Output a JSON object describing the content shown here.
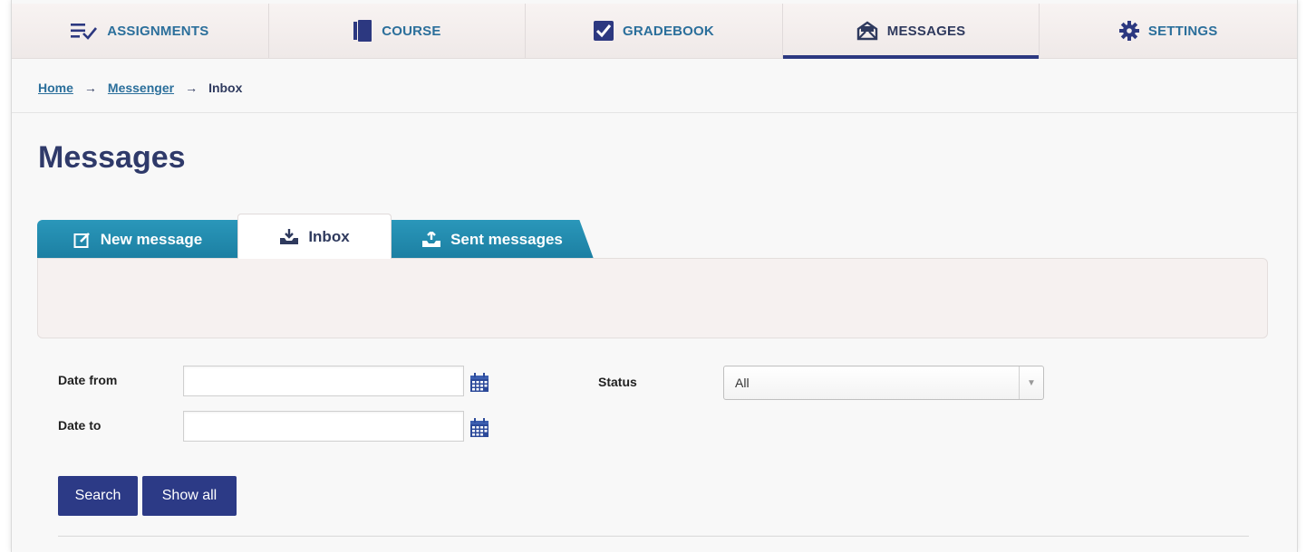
{
  "nav": {
    "items": [
      {
        "label": "ASSIGNMENTS",
        "icon": "checklist-icon"
      },
      {
        "label": "COURSE",
        "icon": "book-icon"
      },
      {
        "label": "GRADEBOOK",
        "icon": "checkbox-icon"
      },
      {
        "label": "MESSAGES",
        "icon": "envelope-icon"
      },
      {
        "label": "SETTINGS",
        "icon": "gear-icon"
      }
    ],
    "active": "MESSAGES"
  },
  "breadcrumb": {
    "home": "Home",
    "messenger": "Messenger",
    "current": "Inbox",
    "separator": "→"
  },
  "page": {
    "title": "Messages"
  },
  "tabs": {
    "new_message": "New message",
    "inbox": "Inbox",
    "sent_messages": "Sent messages",
    "active": "Inbox"
  },
  "filters": {
    "date_from_label": "Date from",
    "date_from_value": "",
    "date_to_label": "Date to",
    "date_to_value": "",
    "status_label": "Status",
    "status_value": "All"
  },
  "buttons": {
    "search": "Search",
    "show_all": "Show all"
  },
  "colors": {
    "nav_text": "#2b6f9b",
    "active_underline": "#2c3880",
    "tab_blue": "#1c87ac",
    "button_navy": "#2c3a86",
    "title": "#2f3a6a"
  }
}
